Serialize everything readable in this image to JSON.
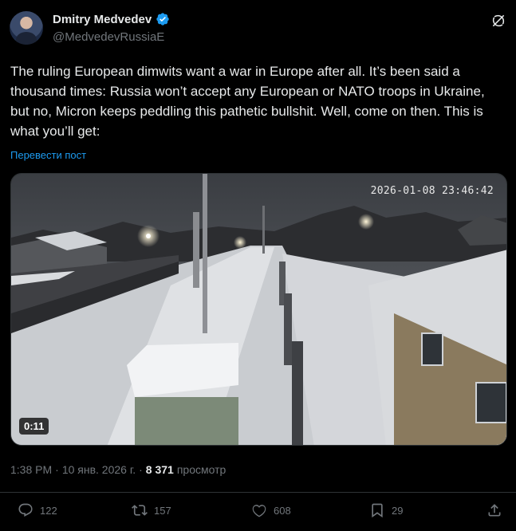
{
  "author": {
    "name": "Dmitry Medvedev",
    "handle": "@MedvedevRussiaE"
  },
  "tweet": {
    "text": "The ruling European dimwits want a war in Europe after all. It’s been said a thousand times: Russia won’t accept any European or NATO troops in Ukraine, but no, Micron keeps peddling this pathetic bullshit. Well, come on then. This is what you’ll get:",
    "translate_label": "Перевести пост"
  },
  "media": {
    "camera_timestamp": "2026-01-08 23:46:42",
    "duration": "0:11"
  },
  "meta": {
    "time": "1:38 PM",
    "separator1": "·",
    "date": "10 янв. 2026 г.",
    "separator2": "·",
    "views_count": "8 371",
    "views_label": "просмотр"
  },
  "actions": {
    "replies": "122",
    "reposts": "157",
    "likes": "608",
    "bookmarks": "29"
  },
  "colors": {
    "background": "#000000",
    "text": "#e7e9ea",
    "secondary": "#71767b",
    "link": "#1d9bf0",
    "verified": "#1d9bf0"
  }
}
